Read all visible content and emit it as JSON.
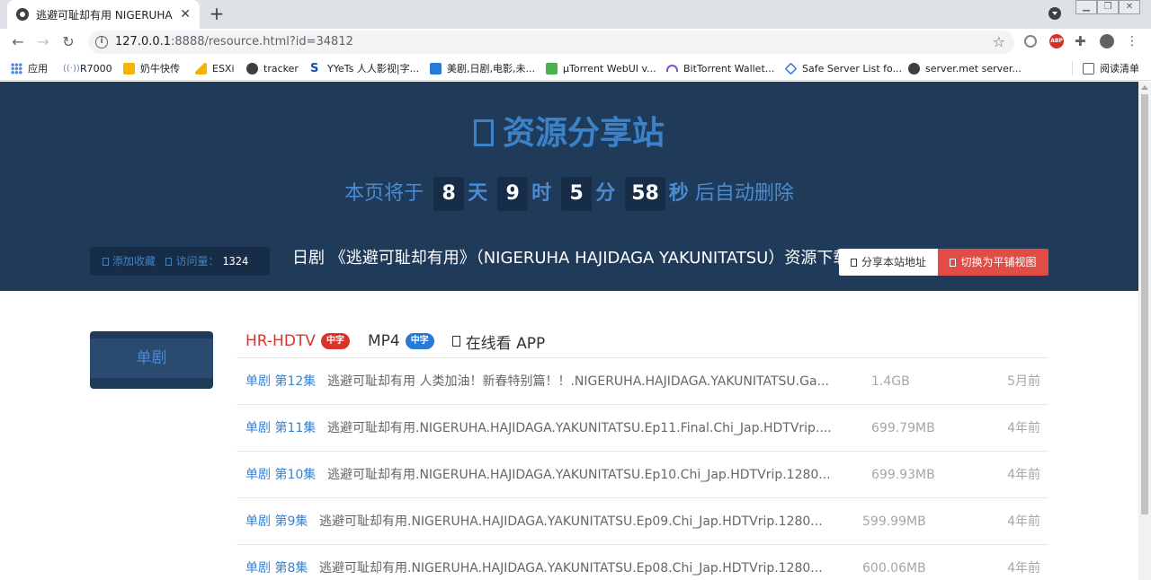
{
  "browser": {
    "tab_title": "逃避可耻却有用 NIGERUHA HA",
    "url_host": "127.0.0.1",
    "url_rest": ":8888/resource.html?id=34812",
    "bookmarks": [
      {
        "label": "应用",
        "icon": "apps-grid-icon",
        "color": "#4285f4"
      },
      {
        "label": "R7000",
        "icon": "wifi-icon",
        "color": "#4a8bd1"
      },
      {
        "label": "奶牛快传",
        "icon": "cow-icon",
        "color": "#f5b400"
      },
      {
        "label": "ESXi",
        "icon": "esxi-icon",
        "color": "#f5b400"
      },
      {
        "label": "tracker",
        "icon": "globe-icon",
        "color": "#3c4043"
      },
      {
        "label": "YYeTs 人人影视|字...",
        "icon": "yyets-icon",
        "color": "#1a4fa0"
      },
      {
        "label": "美剧,日剧,电影,未...",
        "icon": "chart-icon",
        "color": "#2a79d6"
      },
      {
        "label": "µTorrent WebUI v...",
        "icon": "utorrent-icon",
        "color": "#4caf50"
      },
      {
        "label": "BitTorrent Wallet...",
        "icon": "bittorrent-icon",
        "color": "#7e57c2"
      },
      {
        "label": "Safe Server List fo...",
        "icon": "diamond-icon",
        "color": "#2a79d6"
      },
      {
        "label": "server.met server...",
        "icon": "globe-icon",
        "color": "#3c4043"
      },
      {
        "label": "阅读清单",
        "icon": "reading-list-icon",
        "color": "#5f6368"
      }
    ]
  },
  "site": {
    "title": "资源分享站",
    "countdown": {
      "prefix": "本页将于",
      "days": "8",
      "days_unit": "天",
      "hours": "9",
      "hours_unit": "时",
      "minutes": "5",
      "minutes_unit": "分",
      "seconds": "58",
      "seconds_unit": "秒",
      "suffix": "后自动删除"
    },
    "favorite_label": "添加收藏",
    "views_label": "访问量：",
    "views_count": "1324",
    "resource_name": "日剧 《逃避可耻却有用》（NIGERUHA HAJIDAGA YAKUNITATSU）资源下载",
    "share_button": "分享本站地址",
    "toggle_button": "切换为平铺视图"
  },
  "sidebar": {
    "active_tab": "单剧"
  },
  "formats": [
    {
      "label": "HR-HDTV",
      "badge": "中字",
      "color": "#d9342b",
      "badge_color": "#d9342b"
    },
    {
      "label": "MP4",
      "badge": "中字",
      "color": "#333333",
      "badge_color": "#2a79d6"
    },
    {
      "label": "在线看 APP",
      "color": "#333333"
    }
  ],
  "episodes": [
    {
      "ep": "单剧 第12集",
      "name": "逃避可耻却有用 人类加油！新春特别篇！！.NIGERUHA.HAJIDAGA.YAKUNITATSU.Ga...",
      "size": "1.4GB",
      "time": "5月前"
    },
    {
      "ep": "单剧 第11集",
      "name": "逃避可耻却有用.NIGERUHA.HAJIDAGA.YAKUNITATSU.Ep11.Final.Chi_Jap.HDTVrip....",
      "size": "699.79MB",
      "time": "4年前"
    },
    {
      "ep": "单剧 第10集",
      "name": "逃避可耻却有用.NIGERUHA.HAJIDAGA.YAKUNITATSU.Ep10.Chi_Jap.HDTVrip.1280...",
      "size": "699.93MB",
      "time": "4年前"
    },
    {
      "ep": "单剧 第9集",
      "name": "逃避可耻却有用.NIGERUHA.HAJIDAGA.YAKUNITATSU.Ep09.Chi_Jap.HDTVrip.1280...",
      "size": "599.99MB",
      "time": "4年前"
    },
    {
      "ep": "单剧 第8集",
      "name": "逃避可耻却有用.NIGERUHA.HAJIDAGA.YAKUNITATSU.Ep08.Chi_Jap.HDTVrip.1280...",
      "size": "600.06MB",
      "time": "4年前"
    }
  ]
}
